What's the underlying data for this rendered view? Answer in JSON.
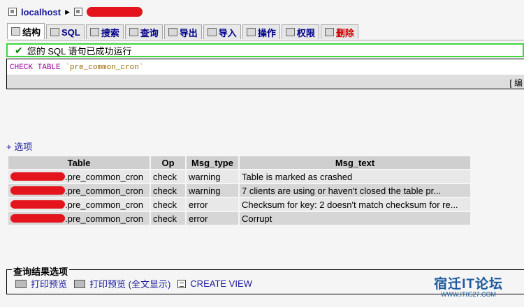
{
  "breadcrumb": {
    "server": "localhost"
  },
  "tabs": [
    {
      "label": "结构",
      "icon": "structure-icon"
    },
    {
      "label": "SQL",
      "icon": "sql-icon"
    },
    {
      "label": "搜索",
      "icon": "search-icon"
    },
    {
      "label": "查询",
      "icon": "query-icon"
    },
    {
      "label": "导出",
      "icon": "export-icon"
    },
    {
      "label": "导入",
      "icon": "import-icon"
    },
    {
      "label": "操作",
      "icon": "operations-icon"
    },
    {
      "label": "权限",
      "icon": "privileges-icon"
    },
    {
      "label": "删除",
      "icon": "drop-icon"
    }
  ],
  "success": {
    "message": "您的 SQL 语句已成功运行"
  },
  "sql": {
    "keyword1": "CHECK",
    "keyword2": "TABLE",
    "identifier": "`pre_common_cron`",
    "bar_text": "[ 编"
  },
  "options": {
    "label": "+ 选项"
  },
  "table": {
    "headers": [
      "Table",
      "Op",
      "Msg_type",
      "Msg_text"
    ],
    "rows": [
      {
        "table": ".pre_common_cron",
        "op": "check",
        "type": "warning",
        "text": "Table is marked as crashed"
      },
      {
        "table": ".pre_common_cron",
        "op": "check",
        "type": "warning",
        "text": "7 clients are using or haven't closed the table pr..."
      },
      {
        "table": ".pre_common_cron",
        "op": "check",
        "type": "error",
        "text": "Checksum for key:  2 doesn't match checksum for re..."
      },
      {
        "table": ".pre_common_cron",
        "op": "check",
        "type": "error",
        "text": "Corrupt"
      }
    ]
  },
  "query_options": {
    "legend": "查询结果选项",
    "print_view": "打印预览",
    "print_view_full": "打印预览 (全文显示)",
    "create_view": "CREATE VIEW"
  },
  "watermark": {
    "main": "宿迁IT论坛",
    "sub": "WWW.IT0527.COM"
  },
  "colors": {
    "success_border": "#3fd63f",
    "link": "#1a1a9a",
    "redaction": "#e3141b",
    "keyword": "#990099"
  }
}
